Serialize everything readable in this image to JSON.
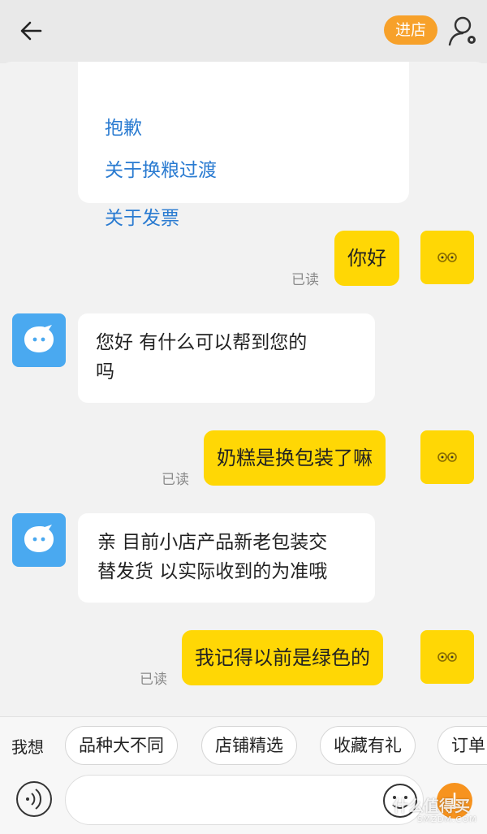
{
  "header": {
    "enter_store_label": "进店"
  },
  "faq_card": {
    "partial_item": "抱歉",
    "items": [
      "关于换粮过渡",
      "关于发票"
    ]
  },
  "messages": [
    {
      "side": "right",
      "text": "你好",
      "read": "已读"
    },
    {
      "side": "left",
      "lines": [
        "您好 有什么可以帮到您的",
        "吗"
      ]
    },
    {
      "side": "right",
      "text": "奶糕是换包装了嘛",
      "read": "已读"
    },
    {
      "side": "left",
      "lines": [
        "亲 目前小店产品新老包装交",
        "替发货 以实际收到的为准哦"
      ]
    },
    {
      "side": "right",
      "text": "我记得以前是绿色的",
      "read": "已读"
    }
  ],
  "quick_replies": {
    "label": "我想",
    "chips": [
      "品种大不同",
      "店铺精选",
      "收藏有礼",
      "订单"
    ]
  },
  "input": {
    "placeholder": ""
  },
  "watermark": {
    "main": "什么值得买",
    "sub": "SMZDM.COM"
  },
  "colors": {
    "accent_orange": "#f7a12a",
    "bubble_yellow": "#ffd705",
    "link_blue": "#2a7bd1",
    "bot_avatar_blue": "#4aa9f0"
  }
}
